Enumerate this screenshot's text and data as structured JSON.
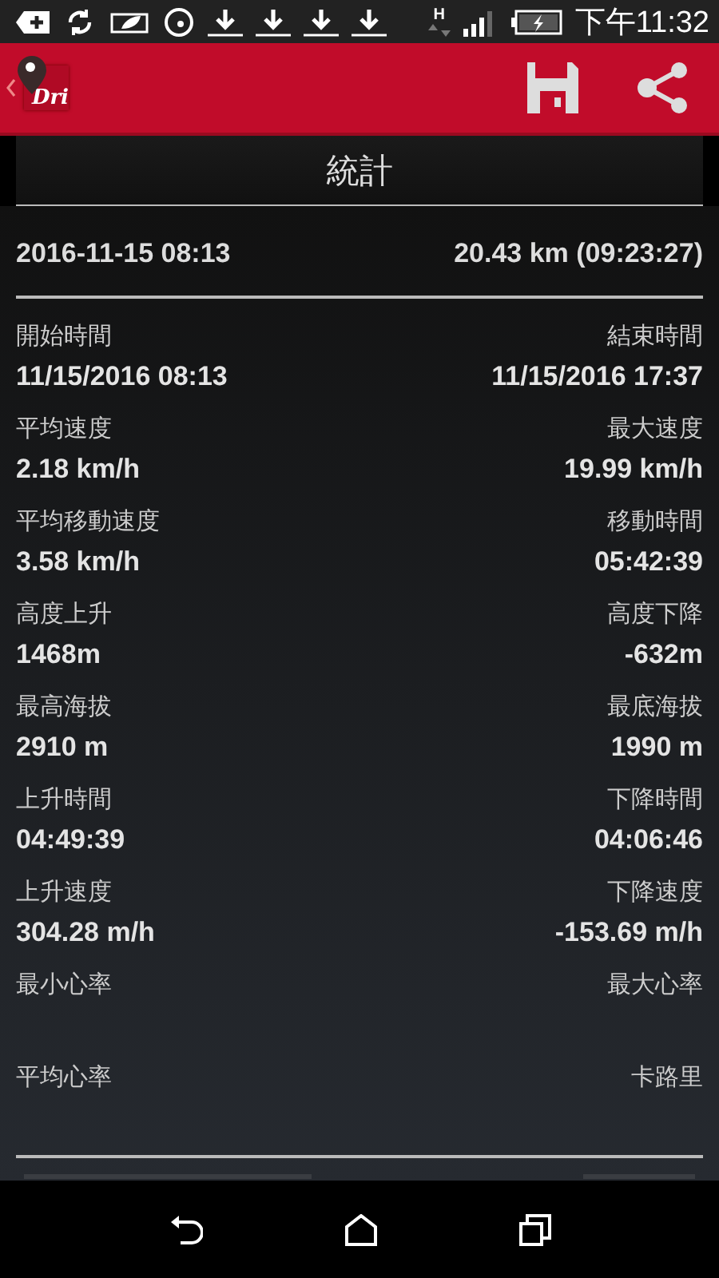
{
  "status_bar": {
    "network": "H",
    "time": "下午11:32"
  },
  "app_bar": {
    "logo_text": "Dri"
  },
  "section_title": "統計",
  "summary": {
    "date": "2016-11-15 08:13",
    "distance": "20.43 km (09:23:27)"
  },
  "stats": [
    {
      "left": {
        "label": "開始時間",
        "value": "11/15/2016 08:13"
      },
      "right": {
        "label": "結束時間",
        "value": "11/15/2016 17:37"
      }
    },
    {
      "left": {
        "label": "平均速度",
        "value": "2.18 km/h"
      },
      "right": {
        "label": "最大速度",
        "value": "19.99 km/h"
      }
    },
    {
      "left": {
        "label": "平均移動速度",
        "value": "3.58 km/h"
      },
      "right": {
        "label": "移動時間",
        "value": "05:42:39"
      }
    },
    {
      "left": {
        "label": "高度上升",
        "value": "1468m"
      },
      "right": {
        "label": "高度下降",
        "value": "-632m"
      }
    },
    {
      "left": {
        "label": "最高海拔",
        "value": "2910 m"
      },
      "right": {
        "label": "最底海拔",
        "value": "1990 m"
      }
    },
    {
      "left": {
        "label": "上升時間",
        "value": "04:49:39"
      },
      "right": {
        "label": "下降時間",
        "value": "04:06:46"
      }
    },
    {
      "left": {
        "label": "上升速度",
        "value": "304.28 m/h"
      },
      "right": {
        "label": "下降速度",
        "value": "-153.69 m/h"
      }
    },
    {
      "left": {
        "label": "最小心率"
      },
      "right": {
        "label": "最大心率"
      }
    },
    {
      "left": {
        "label": "平均心率"
      },
      "right": {
        "label": "卡路里"
      }
    }
  ]
}
